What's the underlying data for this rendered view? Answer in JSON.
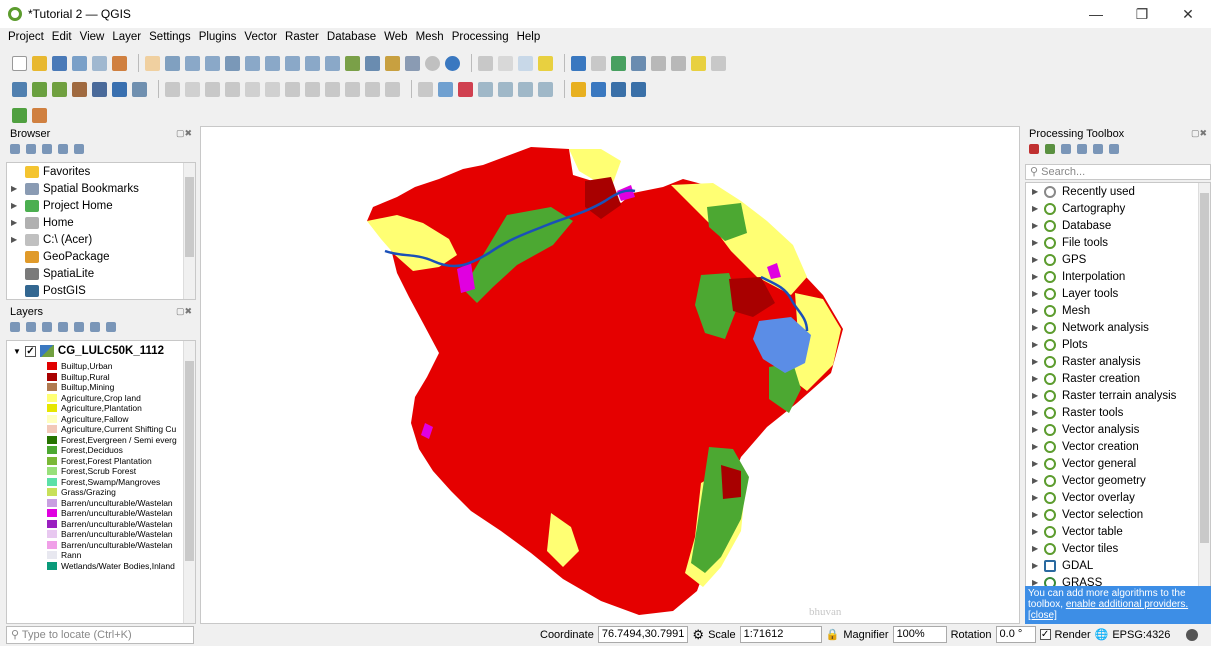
{
  "window": {
    "title": "*Tutorial 2 — QGIS"
  },
  "menu": [
    "Project",
    "Edit",
    "View",
    "Layer",
    "Settings",
    "Plugins",
    "Vector",
    "Raster",
    "Database",
    "Web",
    "Mesh",
    "Processing",
    "Help"
  ],
  "browser": {
    "title": "Browser",
    "items": [
      {
        "label": "Favorites",
        "icon": "star-icon",
        "expand": false,
        "color": "#f4c430"
      },
      {
        "label": "Spatial Bookmarks",
        "icon": "bookmark-icon",
        "expand": true,
        "color": "#8a9bb3"
      },
      {
        "label": "Project Home",
        "icon": "folder-green-icon",
        "expand": true,
        "color": "#4caf50"
      },
      {
        "label": "Home",
        "icon": "home-icon",
        "expand": true,
        "color": "#b0b0b0"
      },
      {
        "label": "C:\\ (Acer)",
        "icon": "drive-icon",
        "expand": true,
        "color": "#c0c0c0"
      },
      {
        "label": "GeoPackage",
        "icon": "geopackage-icon",
        "expand": false,
        "color": "#e09a2a"
      },
      {
        "label": "SpatiaLite",
        "icon": "feather-icon",
        "expand": false,
        "color": "#7a7a7a"
      },
      {
        "label": "PostGIS",
        "icon": "elephant-icon",
        "expand": false,
        "color": "#336791"
      }
    ]
  },
  "layers": {
    "title": "Layers",
    "layer_name": "CG_LULC50K_1112",
    "legend": [
      {
        "label": "Builtup,Urban",
        "color": "#e00000"
      },
      {
        "label": "Builtup,Rural",
        "color": "#a80000"
      },
      {
        "label": "Builtup,Mining",
        "color": "#b07a50"
      },
      {
        "label": "Agriculture,Crop land",
        "color": "#ffff73"
      },
      {
        "label": "Agriculture,Plantation",
        "color": "#e6e600"
      },
      {
        "label": "Agriculture,Fallow",
        "color": "#ffffbe"
      },
      {
        "label": "Agriculture,Current Shifting Cu",
        "color": "#f2c8b8"
      },
      {
        "label": "Forest,Evergreen / Semi everg",
        "color": "#267300"
      },
      {
        "label": "Forest,Deciduos",
        "color": "#4ca832"
      },
      {
        "label": "Forest,Forest Plantation",
        "color": "#7ab836"
      },
      {
        "label": "Forest,Scrub Forest",
        "color": "#98e07a"
      },
      {
        "label": "Forest,Swamp/Mangroves",
        "color": "#5ce0a8"
      },
      {
        "label": "Grass/Grazing",
        "color": "#c8e05a"
      },
      {
        "label": "Barren/unculturable/Wastelan",
        "color": "#c8a0e0"
      },
      {
        "label": "Barren/unculturable/Wastelan",
        "color": "#e000e0"
      },
      {
        "label": "Barren/unculturable/Wastelan",
        "color": "#9a20c0"
      },
      {
        "label": "Barren/unculturable/Wastelan",
        "color": "#e8c8f0"
      },
      {
        "label": "Barren/unculturable/Wastelan",
        "color": "#f0a0e8"
      },
      {
        "label": "Rann",
        "color": "#e8e8f0"
      },
      {
        "label": "Wetlands/Water Bodies,Inland",
        "color": "#0a9a7a"
      }
    ]
  },
  "toolbox": {
    "title": "Processing Toolbox",
    "search_placeholder": "Search...",
    "items": [
      {
        "label": "Recently used",
        "icon": "clock-icon"
      },
      {
        "label": "Cartography",
        "icon": "qgis-icon"
      },
      {
        "label": "Database",
        "icon": "qgis-icon"
      },
      {
        "label": "File tools",
        "icon": "qgis-icon"
      },
      {
        "label": "GPS",
        "icon": "qgis-icon"
      },
      {
        "label": "Interpolation",
        "icon": "qgis-icon"
      },
      {
        "label": "Layer tools",
        "icon": "qgis-icon"
      },
      {
        "label": "Mesh",
        "icon": "qgis-icon"
      },
      {
        "label": "Network analysis",
        "icon": "qgis-icon"
      },
      {
        "label": "Plots",
        "icon": "qgis-icon"
      },
      {
        "label": "Raster analysis",
        "icon": "qgis-icon"
      },
      {
        "label": "Raster creation",
        "icon": "qgis-icon"
      },
      {
        "label": "Raster terrain analysis",
        "icon": "qgis-icon"
      },
      {
        "label": "Raster tools",
        "icon": "qgis-icon"
      },
      {
        "label": "Vector analysis",
        "icon": "qgis-icon"
      },
      {
        "label": "Vector creation",
        "icon": "qgis-icon"
      },
      {
        "label": "Vector general",
        "icon": "qgis-icon"
      },
      {
        "label": "Vector geometry",
        "icon": "qgis-icon"
      },
      {
        "label": "Vector overlay",
        "icon": "qgis-icon"
      },
      {
        "label": "Vector selection",
        "icon": "qgis-icon"
      },
      {
        "label": "Vector table",
        "icon": "qgis-icon"
      },
      {
        "label": "Vector tiles",
        "icon": "qgis-icon"
      },
      {
        "label": "GDAL",
        "icon": "gdal-icon"
      },
      {
        "label": "GRASS",
        "icon": "grass-icon"
      }
    ],
    "info_text": "You can add more algorithms to the toolbox,",
    "info_link": "enable additional providers.",
    "info_close": "[close]"
  },
  "map": {
    "watermark": "bhuvan"
  },
  "status": {
    "locate_placeholder": "Type to locate (Ctrl+K)",
    "coordinate_label": "Coordinate",
    "coordinate": "76.7494,30.7991",
    "scale_label": "Scale",
    "scale": "1:71612",
    "magnifier_label": "Magnifier",
    "magnifier": "100%",
    "rotation_label": "Rotation",
    "rotation": "0.0 °",
    "render_label": "Render",
    "crs": "EPSG:4326"
  }
}
